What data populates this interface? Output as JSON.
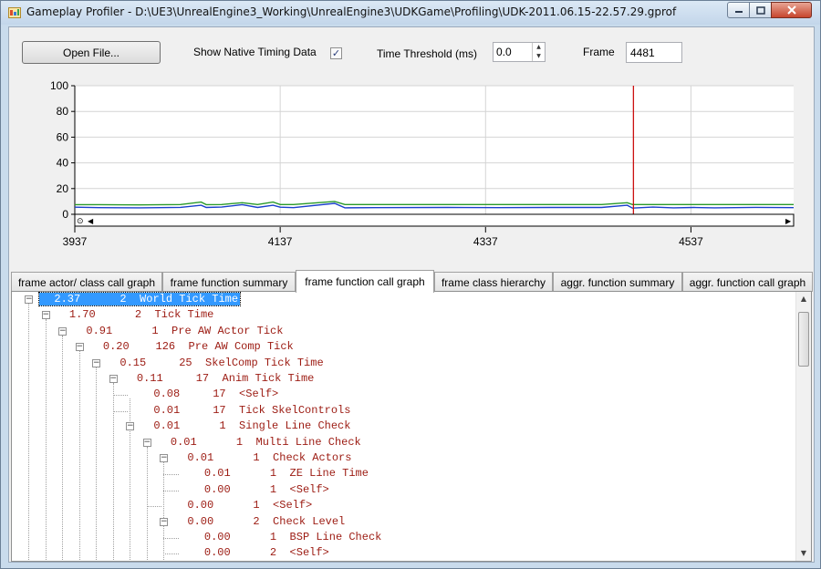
{
  "window": {
    "title": "Gameplay Profiler - D:\\UE3\\UnrealEngine3_Working\\UnrealEngine3\\UDKGame\\Profiling\\UDK-2011.06.15-22.57.29.gprof",
    "app_icon": "profiler-app-icon",
    "buttons": {
      "minimize": "minimize-icon",
      "maximize": "maximize-icon",
      "close": "close-icon"
    }
  },
  "toolbar": {
    "open_file_label": "Open File...",
    "show_native_label": "Show Native Timing Data",
    "show_native_checked": true,
    "time_threshold_label": "Time Threshold (ms)",
    "time_threshold_value": "0.0",
    "frame_label": "Frame",
    "frame_value": "4481"
  },
  "chart_data": {
    "type": "line",
    "title": "",
    "xlabel": "",
    "ylabel": "",
    "ylim": [
      0,
      100
    ],
    "xlim": [
      3937,
      4637
    ],
    "yticks": [
      0,
      20,
      40,
      60,
      80,
      100
    ],
    "xticks": [
      3937,
      4137,
      4337,
      4537
    ],
    "grid": true,
    "marker_frame": 4481,
    "marker_color": "#cc1111",
    "series": [
      {
        "color": "#2a9a2a",
        "x": [
          3937,
          3960,
          4000,
          4040,
          4060,
          4065,
          4080,
          4100,
          4115,
          4130,
          4137,
          4150,
          4190,
          4200,
          4230,
          4300,
          4350,
          4400,
          4450,
          4475,
          4480,
          4500,
          4520,
          4540,
          4560,
          4600,
          4637
        ],
        "y": [
          7.5,
          7.5,
          7.3,
          7.6,
          9.5,
          7.5,
          7.6,
          9.0,
          7.6,
          9.5,
          7.6,
          7.6,
          10.0,
          7.6,
          7.6,
          7.6,
          7.6,
          7.6,
          7.6,
          9.0,
          7.6,
          7.6,
          7.6,
          7.6,
          7.6,
          7.6,
          7.6
        ]
      },
      {
        "color": "#1a3fcc",
        "x": [
          3937,
          3960,
          4000,
          4040,
          4060,
          4065,
          4080,
          4100,
          4115,
          4130,
          4137,
          4150,
          4190,
          4200,
          4230,
          4300,
          4350,
          4400,
          4450,
          4475,
          4480,
          4500,
          4520,
          4540,
          4560,
          4600,
          4637
        ],
        "y": [
          5.5,
          5.2,
          5.0,
          5.4,
          7.0,
          5.3,
          5.6,
          7.5,
          5.3,
          7.0,
          5.5,
          5.2,
          8.5,
          5.0,
          5.2,
          5.3,
          5.2,
          5.3,
          5.3,
          7.0,
          4.8,
          5.6,
          5.0,
          5.3,
          5.0,
          5.4,
          5.2
        ]
      }
    ]
  },
  "tabs": [
    {
      "label": "frame actor/ class call graph",
      "active": false
    },
    {
      "label": "frame function summary",
      "active": false
    },
    {
      "label": "frame function call graph",
      "active": true
    },
    {
      "label": "frame class hierarchy",
      "active": false
    },
    {
      "label": "aggr. function summary",
      "active": false
    },
    {
      "label": "aggr. function call graph",
      "active": false
    }
  ],
  "tree": {
    "rows": [
      {
        "time": "2.37",
        "count": "2",
        "name": "World Tick Time",
        "depth": 0,
        "expander": "⊟",
        "selected": true
      },
      {
        "time": "1.70",
        "count": "2",
        "name": "Tick Time",
        "depth": 1,
        "expander": "⊟"
      },
      {
        "time": "0.91",
        "count": "1",
        "name": "Pre AW Actor Tick",
        "depth": 2,
        "expander": "⊟"
      },
      {
        "time": "0.20",
        "count": "126",
        "name": "Pre AW Comp Tick",
        "depth": 3,
        "expander": "⊟"
      },
      {
        "time": "0.15",
        "count": "25",
        "name": "SkelComp Tick Time",
        "depth": 4,
        "expander": "⊟"
      },
      {
        "time": "0.11",
        "count": "17",
        "name": "Anim Tick Time",
        "depth": 5,
        "expander": "⊟"
      },
      {
        "time": "0.08",
        "count": "17",
        "name": "<Self>",
        "depth": 6,
        "expander": ""
      },
      {
        "time": "0.01",
        "count": "17",
        "name": "Tick SkelControls",
        "depth": 6,
        "expander": ""
      },
      {
        "time": "0.01",
        "count": "1",
        "name": "Single Line Check",
        "depth": 6,
        "expander": "⊟"
      },
      {
        "time": "0.01",
        "count": "1",
        "name": "Multi Line Check",
        "depth": 7,
        "expander": "⊟"
      },
      {
        "time": "0.01",
        "count": "1",
        "name": "Check Actors",
        "depth": 8,
        "expander": "⊟"
      },
      {
        "time": "0.01",
        "count": "1",
        "name": "ZE Line Time",
        "depth": 9,
        "expander": ""
      },
      {
        "time": "0.00",
        "count": "1",
        "name": "<Self>",
        "depth": 9,
        "expander": ""
      },
      {
        "time": "0.00",
        "count": "1",
        "name": "<Self>",
        "depth": 8,
        "expander": ""
      },
      {
        "time": "0.00",
        "count": "2",
        "name": "Check Level",
        "depth": 8,
        "expander": "⊟"
      },
      {
        "time": "0.00",
        "count": "1",
        "name": "BSP Line Check",
        "depth": 9,
        "expander": ""
      },
      {
        "time": "0.00",
        "count": "2",
        "name": "<Self>",
        "depth": 9,
        "expander": ""
      }
    ]
  },
  "chart_scroll": {
    "left_arrow": "◀",
    "right_arrow": "▶",
    "grip": "⊙"
  },
  "tree_scroll": {
    "up_arrow": "▲",
    "down_arrow": "▼"
  }
}
